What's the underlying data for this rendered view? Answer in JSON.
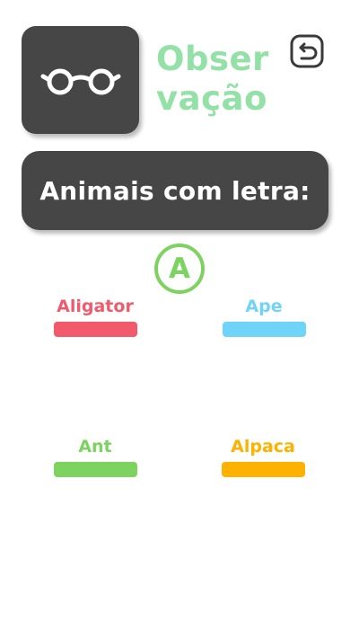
{
  "header": {
    "title_line1": "Obser",
    "title_line2": "vação",
    "icon": "glasses-icon",
    "back_icon": "back-arrow-icon"
  },
  "banner": {
    "text": "Animais com letra:"
  },
  "letter": "A",
  "words": [
    {
      "label": "Aligator",
      "color": "#f25a6c"
    },
    {
      "label": "Ape",
      "color": "#6fd4f7"
    },
    {
      "label": "Ant",
      "color": "#7dd35f"
    },
    {
      "label": "Alpaca",
      "color": "#ffb100"
    }
  ],
  "colors": {
    "title": "#93e1a7",
    "tile": "#464646",
    "letter": "#7dd35f"
  }
}
